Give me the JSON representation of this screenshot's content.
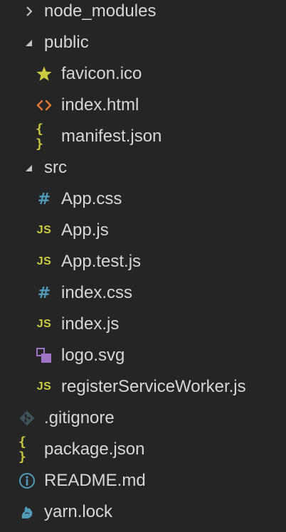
{
  "explorer": {
    "items": [
      {
        "label": "node_modules",
        "type": "folder-collapsed",
        "icon": "caret-right-icon"
      },
      {
        "label": "public",
        "type": "folder-expanded",
        "icon": "caret-down-icon"
      },
      {
        "label": "favicon.ico",
        "type": "file",
        "icon": "star-icon"
      },
      {
        "label": "index.html",
        "type": "file",
        "icon": "html-icon"
      },
      {
        "label": "manifest.json",
        "type": "file",
        "icon": "json-icon"
      },
      {
        "label": "src",
        "type": "folder-expanded",
        "icon": "caret-down-icon"
      },
      {
        "label": "App.css",
        "type": "file",
        "icon": "css-icon"
      },
      {
        "label": "App.js",
        "type": "file",
        "icon": "js-icon"
      },
      {
        "label": "App.test.js",
        "type": "file",
        "icon": "js-icon"
      },
      {
        "label": "index.css",
        "type": "file",
        "icon": "css-icon"
      },
      {
        "label": "index.js",
        "type": "file",
        "icon": "js-icon"
      },
      {
        "label": "logo.svg",
        "type": "file",
        "icon": "svg-icon"
      },
      {
        "label": "registerServiceWorker.js",
        "type": "file",
        "icon": "js-icon"
      },
      {
        "label": ".gitignore",
        "type": "file",
        "icon": "git-icon"
      },
      {
        "label": "package.json",
        "type": "file",
        "icon": "json-icon"
      },
      {
        "label": "README.md",
        "type": "file",
        "icon": "info-icon"
      },
      {
        "label": "yarn.lock",
        "type": "file",
        "icon": "yarn-icon"
      }
    ],
    "icon_glyphs": {
      "js": "JS",
      "css": "#",
      "json": "{ }"
    },
    "colors": {
      "background": "#252526",
      "text": "#d7d7d7",
      "js": "#cbcb41",
      "css": "#519aba",
      "html": "#e37933",
      "svg": "#a074c4",
      "muted": "#6d8086"
    }
  }
}
